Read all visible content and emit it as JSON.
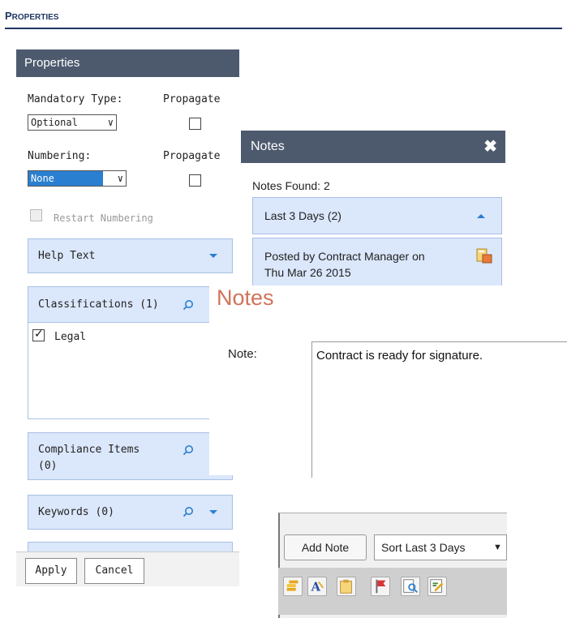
{
  "section": {
    "title_first": "P",
    "title_rest": "ROPERTIES"
  },
  "properties": {
    "header": "Properties",
    "mandatory_type_label": "Mandatory Type:",
    "propagate_label_1": "Propagate",
    "mandatory_type_value": "Optional",
    "numbering_label": "Numbering:",
    "propagate_label_2": "Propagate",
    "numbering_value": "None",
    "restart_numbering_label": "Restart Numbering",
    "help_text_label": "Help Text",
    "classifications_label": "Classifications (1)",
    "classification_items": [
      {
        "label": "Legal",
        "checked": true
      }
    ],
    "compliance_items_label": "Compliance Items",
    "compliance_items_count": "(0)",
    "keywords_label": "Keywords (0)",
    "apply_label": "Apply",
    "cancel_label": "Cancel"
  },
  "notes_popup": {
    "header": "Notes",
    "close_icon": "close-icon",
    "notes_found": "Notes Found: 2",
    "group_label": "Last 3 Days (2)",
    "entry_line1": "Posted by Contract Manager on",
    "entry_line2": "Thu Mar 26 2015"
  },
  "note_editor": {
    "title": "Notes",
    "note_label": "Note:",
    "note_text": "Contract is ready for signature."
  },
  "toolbar": {
    "add_note_label": "Add Note",
    "sort_value": "Sort Last 3 Days",
    "icons": [
      "coins-icon",
      "font-icon",
      "clipboard-icon",
      "flag-icon",
      "search-document-icon",
      "edit-document-icon"
    ]
  },
  "colors": {
    "header_bg": "#4d5a6e",
    "accordion_bg": "#dbe7fb",
    "accent_blue": "#2a7fd0",
    "title_blue": "#1f3864",
    "editor_title": "#d0745a"
  }
}
